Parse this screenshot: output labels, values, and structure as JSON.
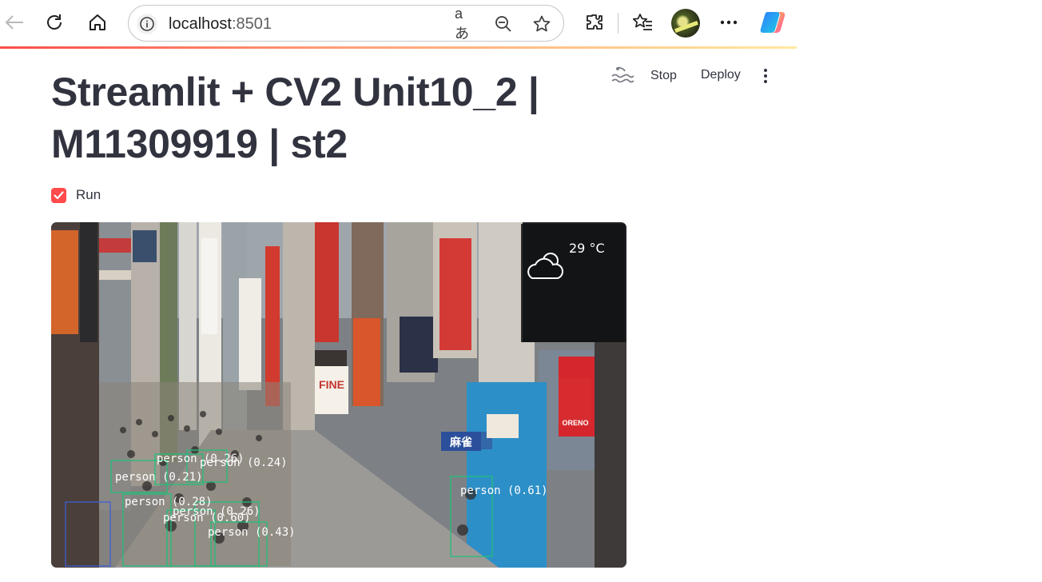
{
  "browser": {
    "url_host": "localhost",
    "url_port": ":8501"
  },
  "app": {
    "title": "Streamlit + CV2 Unit10_2 | M11309919 | st2",
    "header": {
      "stop_label": "Stop",
      "deploy_label": "Deploy"
    },
    "checkbox": {
      "label": "Run",
      "checked": true
    }
  },
  "video_frame": {
    "weather_temp": "29 °C",
    "sign_fine": "FINE",
    "sign_oreno": "ORENO",
    "sign_mahjong": "麻雀",
    "detections": [
      {
        "label": "person (0.61)"
      },
      {
        "label": "person (0.28)"
      },
      {
        "label": "person (0.43)"
      },
      {
        "label": "person (0.21)"
      },
      {
        "label": "person (0.60)"
      },
      {
        "label": "person (0.26)"
      },
      {
        "label": "person (0.26)"
      },
      {
        "label": "person (0.24)"
      }
    ]
  },
  "colors": {
    "accent": "#ff4b4b",
    "text": "#31333f",
    "box": "#21c07a"
  }
}
